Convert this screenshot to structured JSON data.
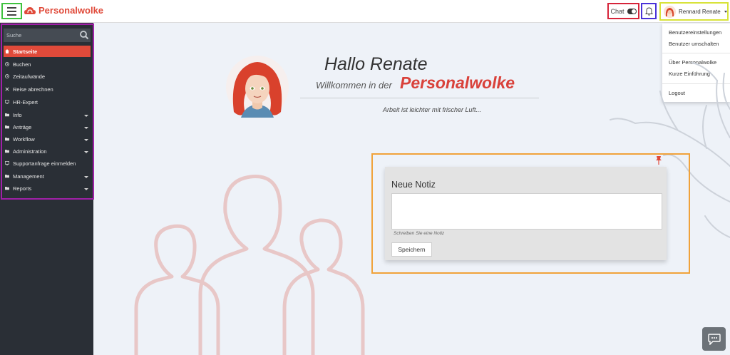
{
  "header": {
    "brand_name": "Personalwolke",
    "chat_label": "Chat",
    "chat_enabled": true,
    "user_name": "Rennard Renate"
  },
  "user_menu": {
    "items": [
      {
        "label": "Benutzereinstellungen"
      },
      {
        "label": "Benutzer umschalten"
      },
      {
        "label": "Über Personalwolke"
      },
      {
        "label": "Kurze Einführung"
      },
      {
        "label": "Logout"
      }
    ]
  },
  "sidebar": {
    "search_placeholder": "Suche",
    "items": [
      {
        "label": "Startseite",
        "icon": "home-icon",
        "active": true
      },
      {
        "label": "Buchen",
        "icon": "clock-icon"
      },
      {
        "label": "Zeitaufwände",
        "icon": "clock-icon"
      },
      {
        "label": "Reise abrechnen",
        "icon": "cross-icon"
      },
      {
        "label": "HR-Expert",
        "icon": "monitor-icon"
      },
      {
        "label": "Info",
        "icon": "folder-icon",
        "expandable": true
      },
      {
        "label": "Anträge",
        "icon": "folder-icon",
        "expandable": true
      },
      {
        "label": "Workflow",
        "icon": "folder-icon",
        "expandable": true
      },
      {
        "label": "Administration",
        "icon": "folder-icon",
        "expandable": true
      },
      {
        "label": "Supportanfrage einmelden",
        "icon": "monitor-icon"
      },
      {
        "label": "Management",
        "icon": "folder-icon",
        "expandable": true
      },
      {
        "label": "Reports",
        "icon": "folder-icon",
        "expandable": true
      }
    ]
  },
  "welcome": {
    "greeting": "Hallo Renate",
    "subtitle": "Willkommen in der",
    "brand": "Personalwolke",
    "tagline": "Arbeit ist leichter mit frischer Luft..."
  },
  "note": {
    "title": "Neue Notiz",
    "value": "",
    "hint": "Schreiben Sie eine Notiz",
    "save_label": "Speichern"
  },
  "colors": {
    "accent": "#e04a3a",
    "sidebar_bg": "#2a2f36"
  }
}
